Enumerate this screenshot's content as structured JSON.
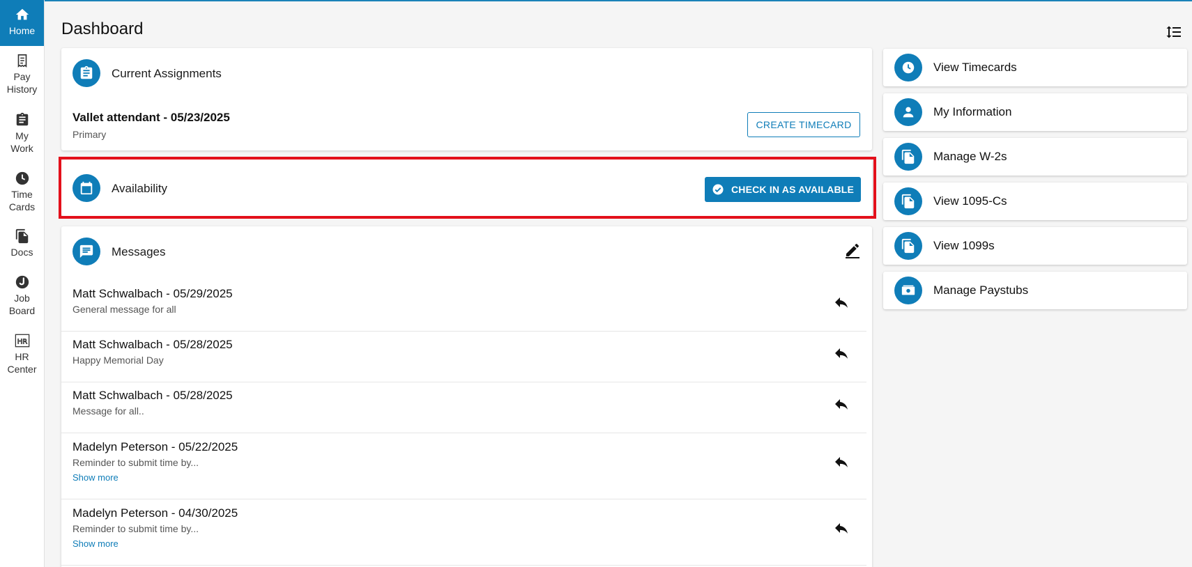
{
  "sidebar": {
    "items": [
      {
        "label": "Home",
        "icon": "home-icon"
      },
      {
        "label": "Pay\nHistory",
        "icon": "receipt-icon"
      },
      {
        "label": "My\nWork",
        "icon": "clipboard-icon"
      },
      {
        "label": "Time\nCards",
        "icon": "clock-icon"
      },
      {
        "label": "Docs",
        "icon": "documents-icon"
      },
      {
        "label": "Job\nBoard",
        "icon": "job-board-icon"
      },
      {
        "label": "HR\nCenter",
        "icon": "hr-icon"
      }
    ]
  },
  "page": {
    "title": "Dashboard"
  },
  "assignments": {
    "title": "Current Assignments",
    "name": "Vallet attendant - 05/23/2025",
    "subtitle": "Primary",
    "button": "CREATE TIMECARD"
  },
  "availability": {
    "title": "Availability",
    "button": "CHECK IN AS AVAILABLE"
  },
  "messages": {
    "title": "Messages",
    "items": [
      {
        "title": "Matt Schwalbach - 05/29/2025",
        "body": "General message for all",
        "more": ""
      },
      {
        "title": "Matt Schwalbach - 05/28/2025",
        "body": "Happy Memorial Day",
        "more": ""
      },
      {
        "title": "Matt Schwalbach - 05/28/2025",
        "body": "Message for all..",
        "more": ""
      },
      {
        "title": "Madelyn Peterson - 05/22/2025",
        "body": "Reminder to submit time by...",
        "more": "Show more"
      },
      {
        "title": "Madelyn Peterson - 04/30/2025",
        "body": "Reminder to submit time by...",
        "more": "Show more"
      }
    ]
  },
  "quick_links": [
    {
      "label": "View Timecards",
      "icon": "clock-icon"
    },
    {
      "label": "My Information",
      "icon": "person-icon"
    },
    {
      "label": "Manage W-2s",
      "icon": "documents-icon"
    },
    {
      "label": "View 1095-Cs",
      "icon": "documents-icon"
    },
    {
      "label": "View 1099s",
      "icon": "documents-icon"
    },
    {
      "label": "Manage Paystubs",
      "icon": "paystub-icon"
    }
  ],
  "colors": {
    "brand": "#0f7db8",
    "highlight": "#e3101b"
  }
}
